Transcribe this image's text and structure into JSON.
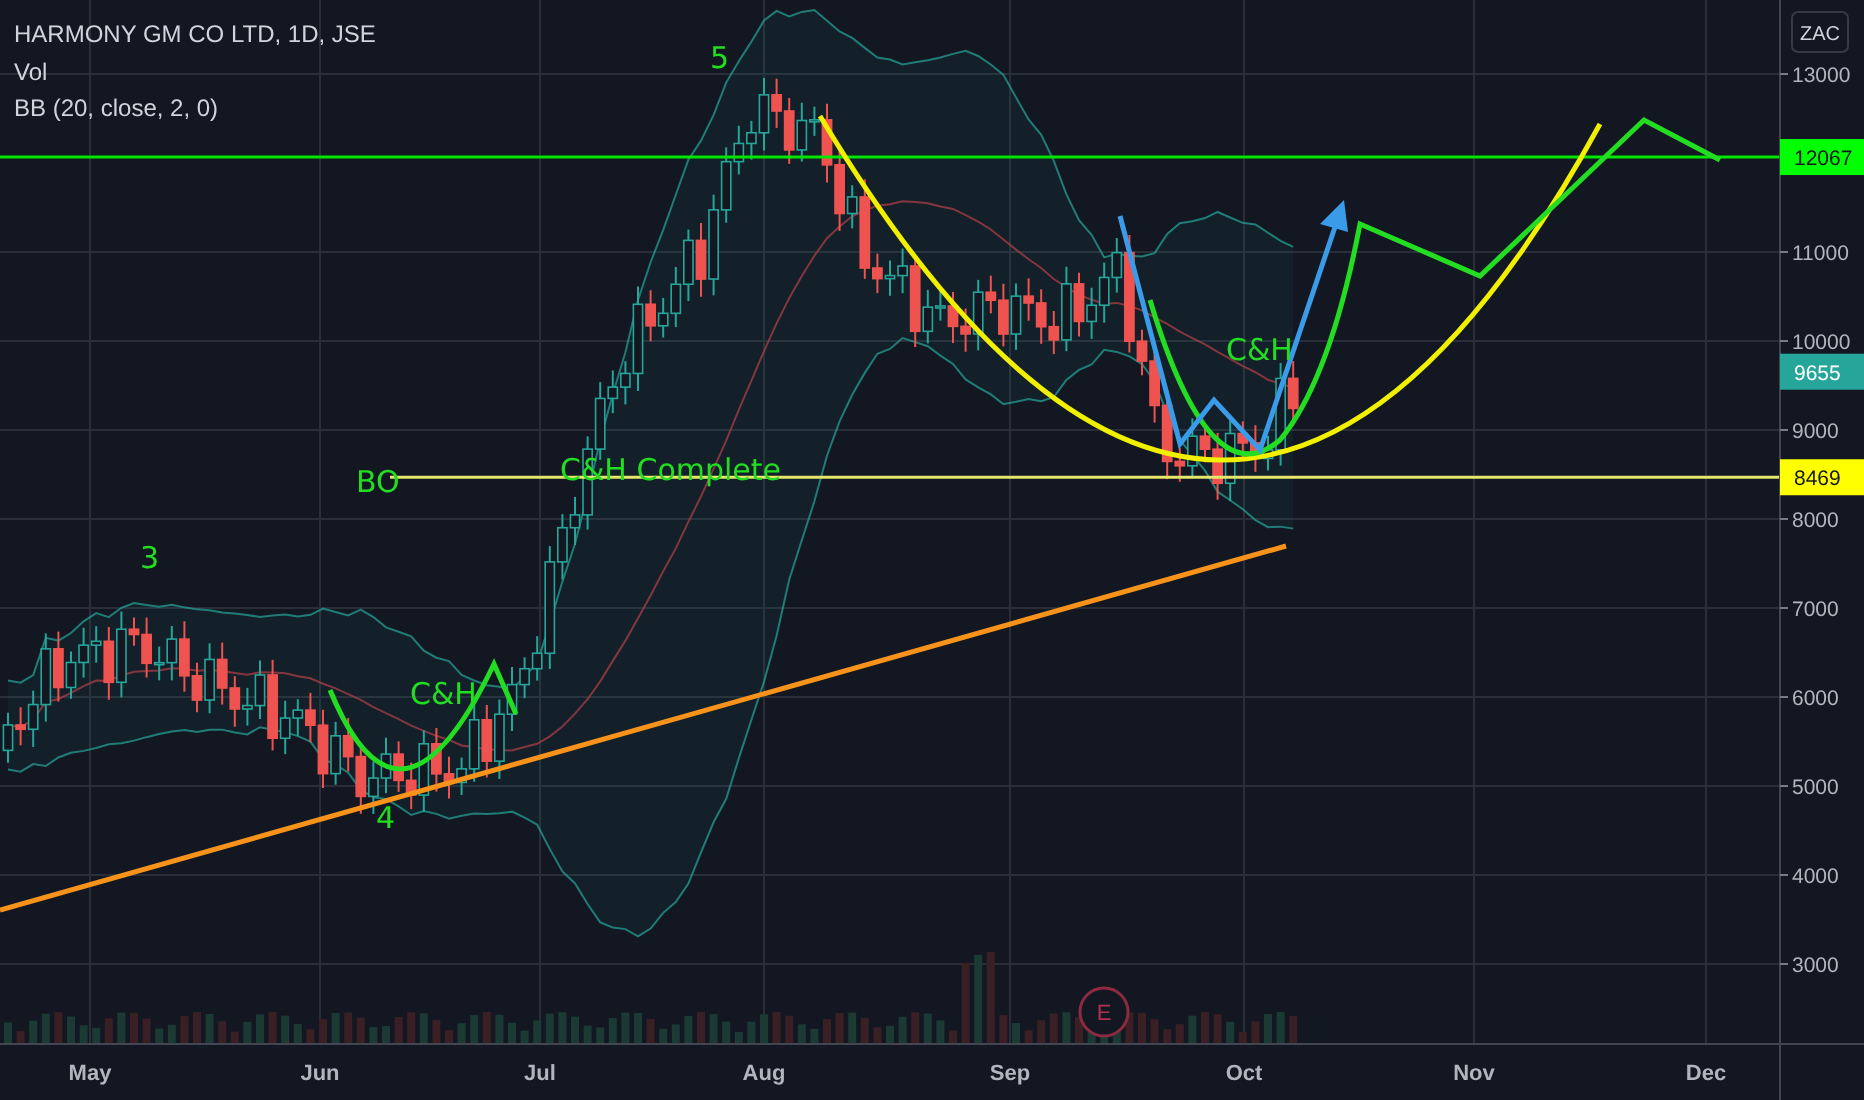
{
  "legend": {
    "title": "HARMONY GM CO LTD, 1D, JSE",
    "indicators": [
      "Vol",
      "BB (20, close, 2, 0)"
    ]
  },
  "currency_button": "ZAC",
  "price_axis": {
    "labels": [
      "13000",
      "11000",
      "10000",
      "9000",
      "8000",
      "7000",
      "6000",
      "5000",
      "4000",
      "3000"
    ]
  },
  "price_tags": [
    {
      "text": "12067",
      "color": "#00ff00"
    },
    {
      "text": "9655",
      "color": "#26a69a"
    },
    {
      "text": "8469",
      "color": "#ffff00"
    }
  ],
  "time_axis": {
    "labels": [
      "May",
      "Jun",
      "Jul",
      "Aug",
      "Sep",
      "Oct",
      "Nov",
      "Dec"
    ]
  },
  "annotations": [
    {
      "text": "5"
    },
    {
      "text": "3"
    },
    {
      "text": "4"
    },
    {
      "text": "C&H"
    },
    {
      "text": "BO"
    },
    {
      "text": "C&H Complete"
    },
    {
      "text": "C&H"
    }
  ],
  "event_marker": "E"
}
